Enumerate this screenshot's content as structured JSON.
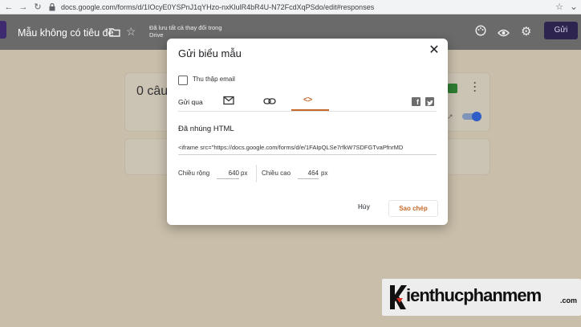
{
  "browser": {
    "url": "docs.google.com/forms/d/1IOcyE0YSPnJ1qYHzo-nxKlulR4bR4U-N72FcdXqPSdo/edit#responses"
  },
  "header": {
    "title": "Mẫu không có tiêu đề",
    "save_status_line1": "Đã lưu tất cả thay đổi trong",
    "save_status_line2": "Drive",
    "send_label": "Gửi"
  },
  "background": {
    "card_title": "0 câu"
  },
  "dialog": {
    "title": "Gửi biểu mẫu",
    "collect_email_label": "Thu thập email",
    "send_via_label": "Gửi qua",
    "embed_tab_glyph": "<>",
    "facebook_glyph": "f",
    "embed_title": "Đã nhúng HTML",
    "embed_code": "<iframe src=\"https://docs.google.com/forms/d/e/1FAIpQLSe7rfkW7SDFGTvaPfnrMD",
    "width_label": "Chiều rộng",
    "width_value": "640",
    "width_unit": "px",
    "height_label": "Chiều cao",
    "height_value": "464",
    "height_unit": "px",
    "cancel_label": "Hủy",
    "copy_label": "Sao chép"
  },
  "watermark": {
    "text": "ienthucphanmem",
    "suffix": ".com"
  },
  "colors": {
    "accent": "#c5692b",
    "brand": "#3e2a6e"
  }
}
